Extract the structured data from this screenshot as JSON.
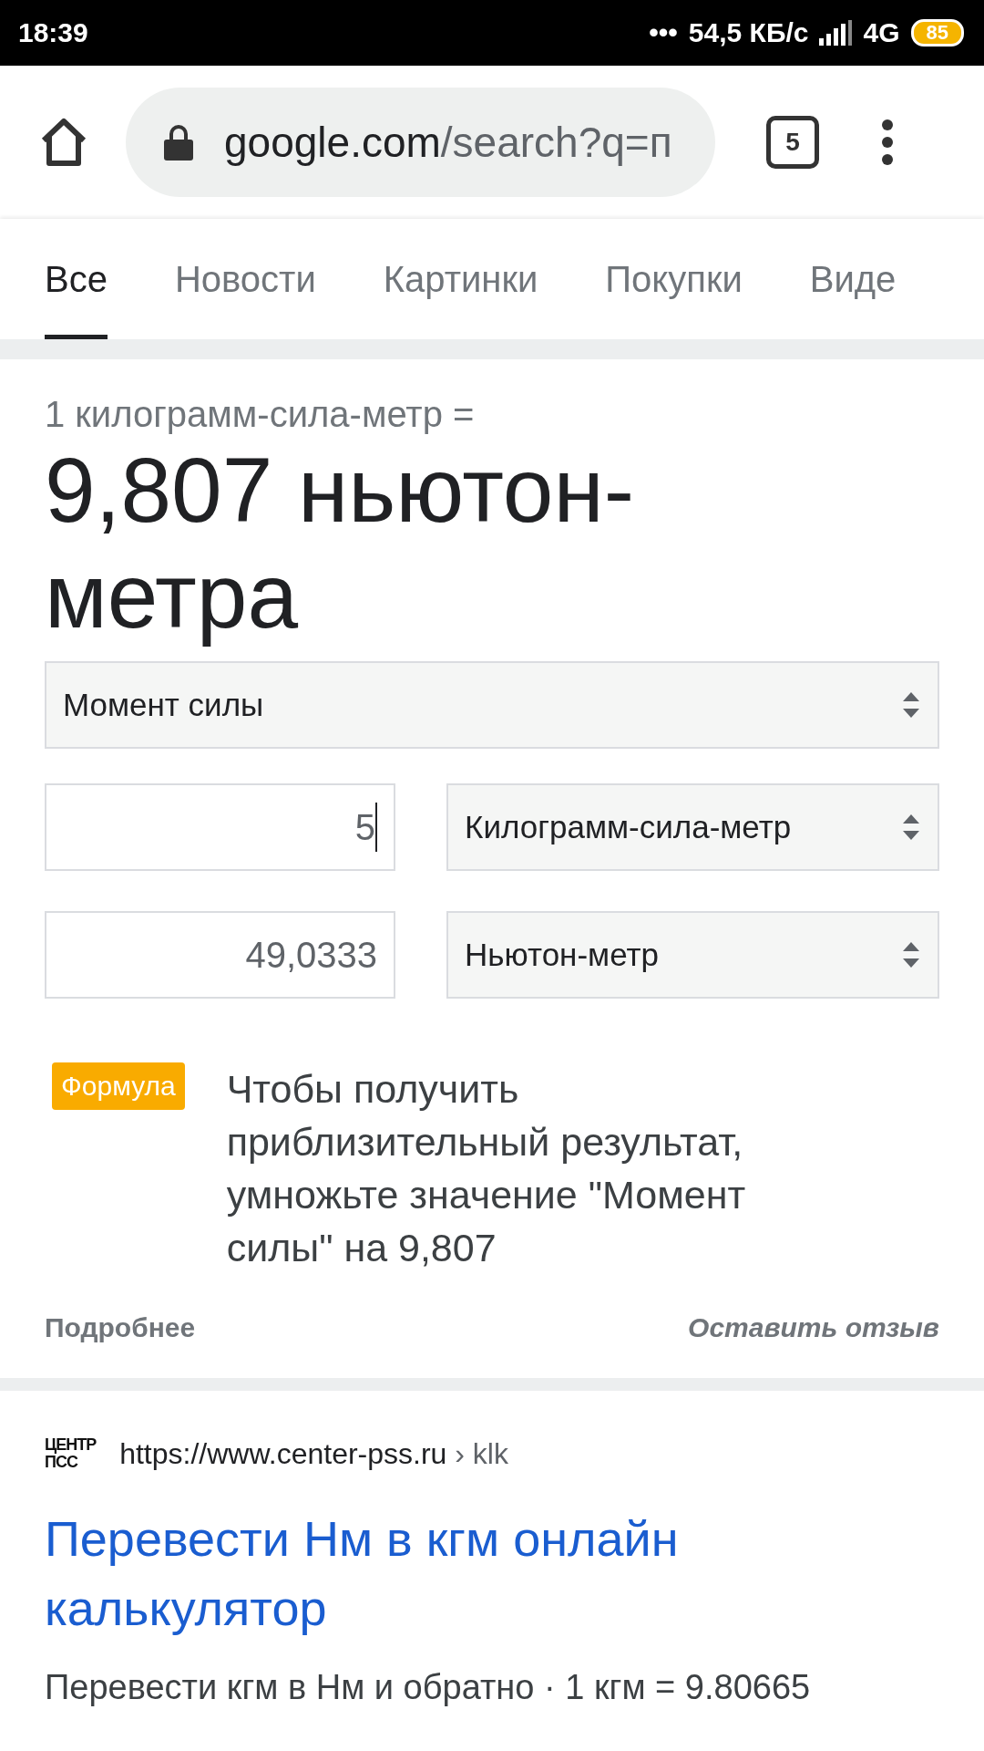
{
  "status_bar": {
    "time": "18:39",
    "more": "•••",
    "speed": "54,5 КБ/с",
    "network": "4G",
    "battery": "85"
  },
  "toolbar": {
    "url_host": "google.com",
    "url_path": "/search?q=п",
    "tab_count": "5"
  },
  "tabs": [
    {
      "label": "Все",
      "selected": true
    },
    {
      "label": "Новости",
      "selected": false
    },
    {
      "label": "Картинки",
      "selected": false
    },
    {
      "label": "Покупки",
      "selected": false
    },
    {
      "label": "Виде",
      "selected": false
    }
  ],
  "converter": {
    "equation_lhs": "1 килограмм-сила-метр =",
    "result": "9,807 ньютон-метра",
    "quantity": "Момент силы",
    "rows": [
      {
        "value": "5",
        "focused": true,
        "unit": "Килограмм-сила-метр"
      },
      {
        "value": "49,0333",
        "focused": false,
        "unit": "Ньютон-метр"
      }
    ],
    "formula_badge": "Формула",
    "formula_text": "Чтобы получить приблизительный результат, умножьте значение \"Момент силы\" на 9,807",
    "more_link": "Подробнее",
    "feedback_link": "Оставить отзыв"
  },
  "result": {
    "site_logo": [
      "ЦЕНТР",
      "ПСС"
    ],
    "url": "https://www.center-pss.ru",
    "breadcrumb": "› klk",
    "title": "Перевести Нм в кгм онлайн калькулятор",
    "snippet": "Перевести кгм в Нм и обратно · 1 кгм = 9.80665"
  }
}
